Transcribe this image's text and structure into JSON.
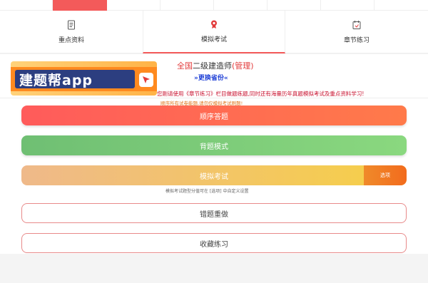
{
  "tabs": [
    {
      "label": "重点资料",
      "icon": "document-icon"
    },
    {
      "label": "模拟考试",
      "icon": "medal-icon"
    },
    {
      "label": "章节练习",
      "icon": "calendar-icon"
    }
  ],
  "banner": {
    "text": "建题帮app"
  },
  "exam": {
    "prefix": "全国",
    "name": "二级建造师",
    "subject": "(管理)",
    "change_province": "»更换省份«"
  },
  "notices": {
    "line1": "您刚请使用《章节练习》栏目做题练题,同时还有海量历年真题模拟考试及重点资料学习!",
    "line2": "顺序所有试卷能题,请勿仅模拟考试刷题!"
  },
  "buttons": {
    "sequence": "顺序答题",
    "memorize": "背题模式",
    "mock": "模拟考试",
    "options": "选项",
    "mock_hint": "模拟考试题型分值可在 [选项] 中自定义设置",
    "wrong": "错题重做",
    "favorites": "收藏练习"
  },
  "colors": {
    "accent": "#f35a5a",
    "green": "#6fbf73",
    "orange": "#f08a2a",
    "link": "#1e3fd6"
  }
}
